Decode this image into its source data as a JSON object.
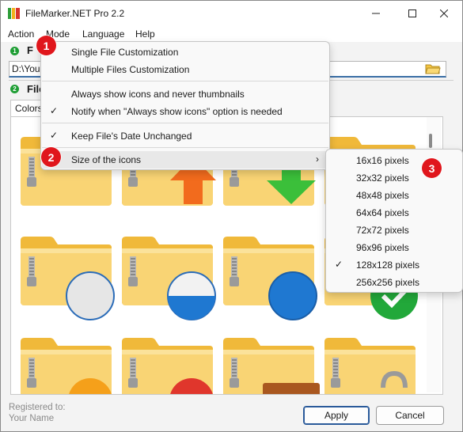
{
  "window": {
    "title": "FileMarker.NET Pro 2.2"
  },
  "menubar": {
    "items": [
      "Action",
      "Mode",
      "Language",
      "Help"
    ]
  },
  "step1": {
    "num": "1",
    "label": "F"
  },
  "path": {
    "value": "D:\\You"
  },
  "step2": {
    "num": "2",
    "label": "File"
  },
  "tab": {
    "label": "Colors"
  },
  "footer": {
    "registered_to": "Registered to:",
    "user": "Your Name"
  },
  "buttons": {
    "apply": "Apply",
    "cancel": "Cancel"
  },
  "dropdown": {
    "single": "Single File Customization",
    "multiple": "Multiple Files Customization",
    "always_icons": "Always show icons and never thumbnails",
    "notify": "Notify when \"Always show icons\" option is needed",
    "keep_date": "Keep File's Date Unchanged",
    "size": "Size of the icons"
  },
  "checks": {
    "mark": "✓"
  },
  "submenu": {
    "items": [
      "16x16 pixels",
      "32x32 pixels",
      "48x48 pixels",
      "64x64 pixels",
      "72x72 pixels",
      "96x96 pixels",
      "128x128 pixels",
      "256x256 pixels"
    ],
    "selected": "128x128 pixels"
  },
  "badges": [
    "1",
    "2",
    "3"
  ],
  "colors": {
    "accent": "#1e9e34",
    "badge": "#e0161c",
    "folder": "#f5c542"
  }
}
